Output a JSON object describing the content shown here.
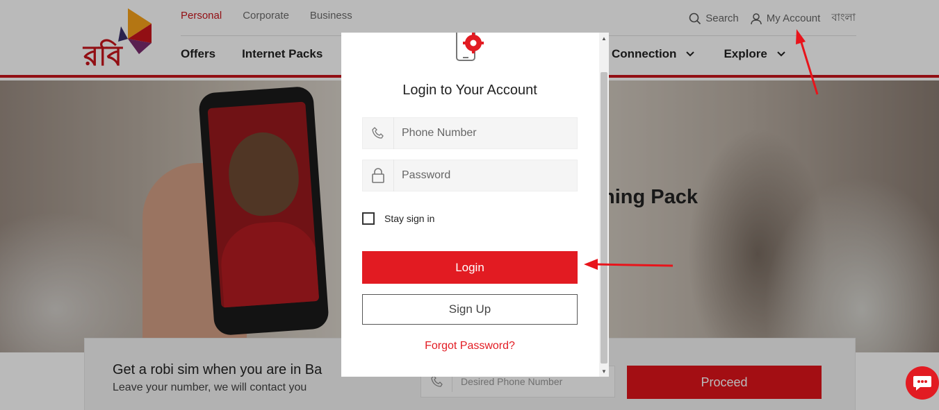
{
  "header": {
    "segments": [
      "Personal",
      "Corporate",
      "Business"
    ],
    "search_label": "Search",
    "account_label": "My Account",
    "language_label": "বাংলা",
    "nav_left": [
      "Offers",
      "Internet Packs"
    ],
    "nav_connection": "w Connection",
    "nav_explore": "Explore",
    "logo_text": "রবি"
  },
  "hero": {
    "title_fragment": "ning Pack"
  },
  "sim_card": {
    "title": "Get a robi sim when you are in Ba",
    "subtitle": "Leave your number, we will contact you",
    "phone_placeholder": "Desired Phone Number",
    "proceed_label": "Proceed"
  },
  "modal": {
    "title": "Login to Your Account",
    "phone_placeholder": "Phone Number",
    "password_placeholder": "Password",
    "stay_signed_label": "Stay sign in",
    "stay_signed_checked": false,
    "login_label": "Login",
    "signup_label": "Sign Up",
    "forgot_label": "Forgot Password?"
  },
  "colors": {
    "brand_red": "#e21b22",
    "annotation_red": "#e8141b"
  },
  "icons": [
    "phone-settings-icon",
    "phone-icon",
    "lock-icon",
    "search-icon",
    "user-icon",
    "chevron-down-icon",
    "chat-icon"
  ]
}
